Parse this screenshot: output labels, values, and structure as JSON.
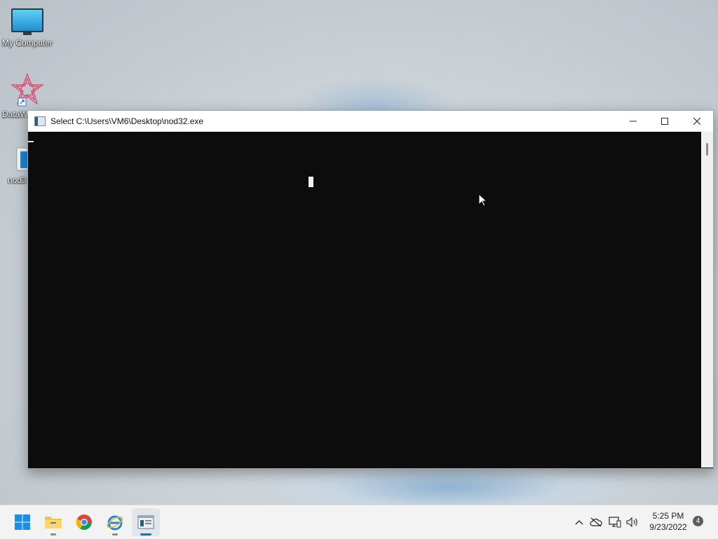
{
  "desktop": {
    "icons": [
      {
        "label": "My Computer"
      },
      {
        "label": "DataW"
      },
      {
        "label": "nod3"
      }
    ]
  },
  "window": {
    "title": "Select C:\\Users\\VM6\\Desktop\\nod32.exe",
    "controls": {
      "minimize": "–",
      "maximize": "☐",
      "close": "✕"
    }
  },
  "taskbar": {
    "apps": [
      {
        "name": "start-button"
      },
      {
        "name": "file-explorer"
      },
      {
        "name": "chrome"
      },
      {
        "name": "internet-explorer"
      },
      {
        "name": "console-host"
      }
    ],
    "tray": {
      "time": "5:25 PM",
      "date": "9/23/2022",
      "notification_count": "4"
    }
  }
}
